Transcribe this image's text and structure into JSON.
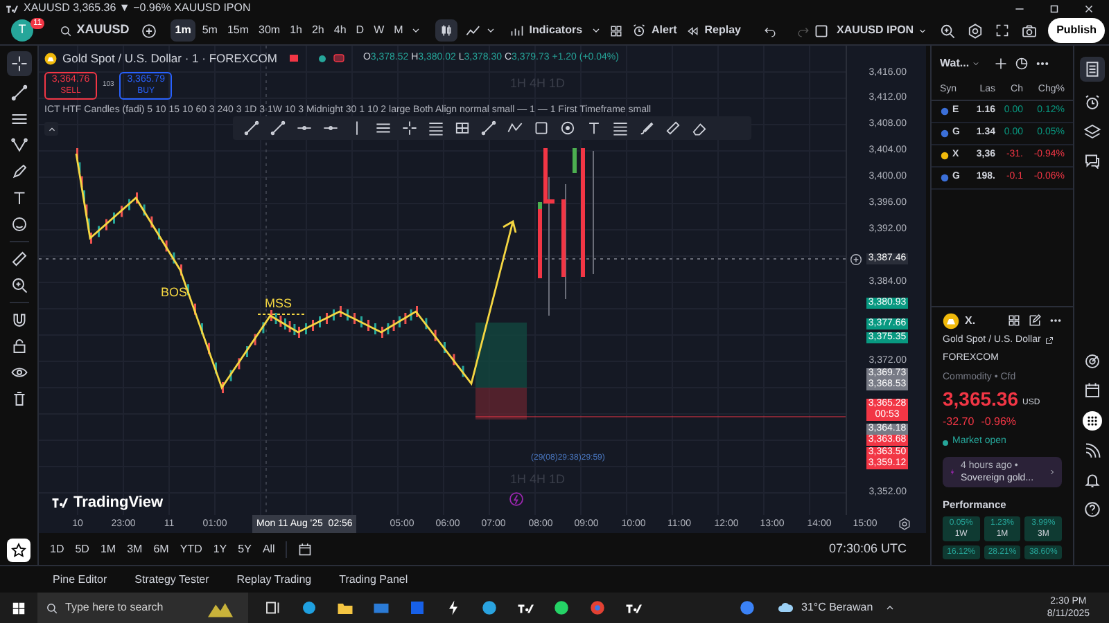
{
  "title_bar": {
    "text": "XAUUSD 3,365.36 ▼ −0.96% XAUUSD IPON"
  },
  "toolbar": {
    "avatar_letter": "T",
    "notification_count": "11",
    "symbol": "XAUUSD",
    "intervals": [
      {
        "label": "1m",
        "selected": true
      },
      {
        "label": "5m",
        "selected": false
      },
      {
        "label": "15m",
        "selected": false
      },
      {
        "label": "30m",
        "selected": false
      },
      {
        "label": "1h",
        "selected": false
      },
      {
        "label": "2h",
        "selected": false
      },
      {
        "label": "4h",
        "selected": false
      },
      {
        "label": "D",
        "selected": false
      },
      {
        "label": "W",
        "selected": false
      },
      {
        "label": "M",
        "selected": false
      }
    ],
    "indicators": "Indicators",
    "alert": "Alert",
    "replay": "Replay",
    "layout_name": "XAUUSD IPON",
    "publish": "Publish"
  },
  "legend": {
    "title": "Gold Spot / U.S. Dollar · 1 · FOREXCOM",
    "ohlc": [
      {
        "key": "O",
        "value": "3,378.52"
      },
      {
        "key": "H",
        "value": "3,380.02"
      },
      {
        "key": "L",
        "value": "3,378.30"
      },
      {
        "key": "C",
        "value": "3,379.73"
      }
    ],
    "change": "+1.20 (+0.04%)",
    "sell_price": "3,364.76",
    "sell_label": "SELL",
    "spread": "103",
    "buy_price": "3,365.79",
    "buy_label": "BUY",
    "indicator": "ICT HTF Candles (fadi) 5 10 15 10 60 3 240 3 1D 3 1W 10 3 Midnight 30 1 10 2 large Both Align normal small — 1 — 1 First Timeframe small"
  },
  "chart": {
    "annotations": [
      "BOS",
      "MSS"
    ],
    "htf_top": "1H 4H 1D",
    "htf_bottom": "1H 4H 1D",
    "htf_timers": "(29(08)29:38)29:59)",
    "logo": "TradingView"
  },
  "price_axis": [
    "3,416.00",
    "3,412.00",
    "3,408.00",
    "3,404.00",
    "3,400.00",
    "3,396.00",
    "3,392.00",
    "3,384.00",
    "3,372.00",
    "3,352.00"
  ],
  "price_badges": [
    {
      "text": "3,387.46",
      "color": "#2a2e39"
    },
    {
      "text": "3,380.93",
      "color": "#089981"
    },
    {
      "text": "3,377.66",
      "color": "#089981"
    },
    {
      "text": "3,375.35",
      "color": "#089981"
    },
    {
      "text": "3,369.73",
      "color": "#787b86"
    },
    {
      "text": "3,368.53",
      "color": "#787b86"
    },
    {
      "text": "3,365.28",
      "timer": "00:53",
      "color": "#f23645"
    },
    {
      "text": "3,364.18",
      "color": "#787b86"
    },
    {
      "text": "3,363.68",
      "color": "#f23645"
    },
    {
      "text": "3,363.50",
      "color": "#f23645"
    },
    {
      "text": "3,359.12",
      "color": "#f23645"
    }
  ],
  "time_axis": [
    "10",
    "23:00",
    "11",
    "01:00",
    "05:00",
    "06:00",
    "07:00",
    "08:00",
    "09:00",
    "10:00",
    "11:00",
    "12:00",
    "13:00",
    "14:00",
    "15:00"
  ],
  "crosshair_time": "Mon 11 Aug '25  02:56",
  "ranges": [
    {
      "label": "1D"
    },
    {
      "label": "5D"
    },
    {
      "label": "1M"
    },
    {
      "label": "3M"
    },
    {
      "label": "6M"
    },
    {
      "label": "YTD"
    },
    {
      "label": "1Y"
    },
    {
      "label": "5Y"
    },
    {
      "label": "All"
    }
  ],
  "clock": "07:30:06 UTC",
  "bottom_tabs": [
    "Pine Editor",
    "Strategy Tester",
    "Replay Trading",
    "Trading Panel"
  ],
  "watchlist": {
    "title": "Wat...",
    "columns": [
      "Syn",
      "Las",
      "Ch",
      "Chg%"
    ],
    "rows": [
      {
        "symbol": "E",
        "last": "1.16",
        "change": "0.00",
        "change_pct": "0.12%",
        "color": "#089981"
      },
      {
        "symbol": "G",
        "last": "1.34",
        "change": "0.00",
        "change_pct": "0.05%",
        "color": "#089981"
      },
      {
        "symbol": "X",
        "last": "3,36",
        "change": "-31.",
        "change_pct": "-0.94%",
        "color": "#f23645"
      },
      {
        "symbol": "G",
        "last": "198.",
        "change": "-0.1",
        "change_pct": "-0.06%",
        "color": "#f23645"
      }
    ]
  },
  "details": {
    "symbol": "X.",
    "name": "Gold Spot / U.S. Dollar",
    "exchange": "FOREXCOM",
    "category": "Commodity • Cfd",
    "price": "3,365.36",
    "currency": "USD",
    "change": "-32.70",
    "change_pct": "-0.96%",
    "status": "Market open",
    "news": {
      "time": "4 hours ago •",
      "headline": "Sovereign gold..."
    },
    "performance_title": "Performance",
    "performance": [
      {
        "value": "0.05%",
        "period": "1W"
      },
      {
        "value": "1.23%",
        "period": "1M"
      },
      {
        "value": "3.99%",
        "period": "3M"
      },
      {
        "value": "16.12%"
      },
      {
        "value": "28.21%"
      },
      {
        "value": "38.60%"
      }
    ]
  },
  "taskbar": {
    "search_placeholder": "Type here to search",
    "weather": "31°C Berawan",
    "time": "2:30 PM",
    "date": "8/11/2025"
  }
}
